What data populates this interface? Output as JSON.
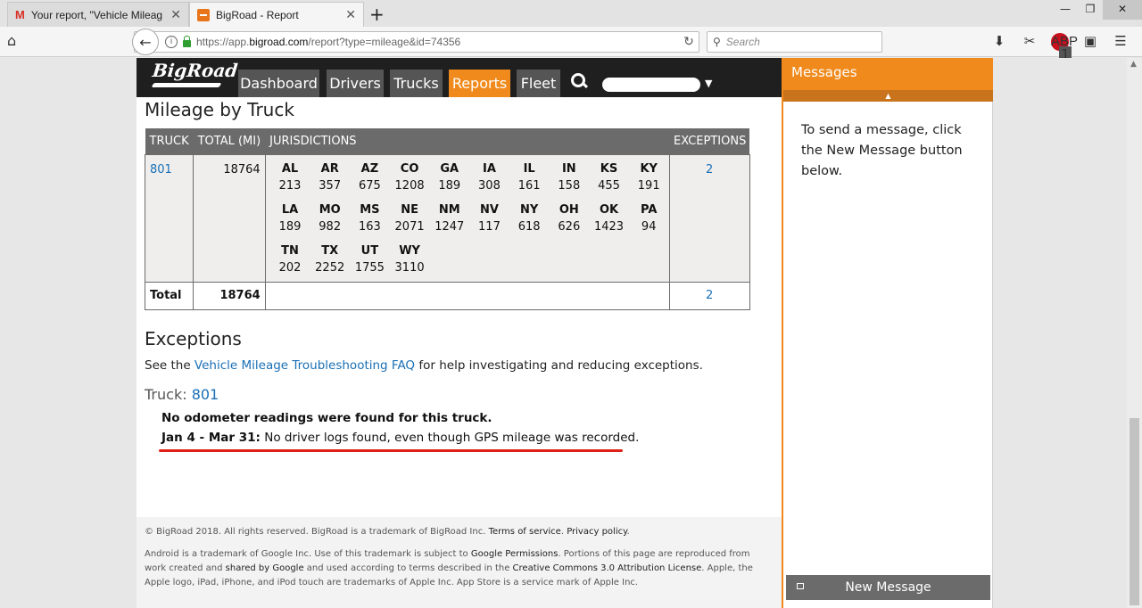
{
  "browser": {
    "tabs": [
      {
        "title": "Your report, \"Vehicle Mileag",
        "favicon": "gmail-icon",
        "active": false
      },
      {
        "title": "BigRoad - Report",
        "favicon": "bigroad-icon",
        "active": true
      }
    ],
    "url_prefix": "https://app.",
    "url_domain": "bigroad.com",
    "url_path": "/report?type=mileage&id=74356",
    "search_placeholder": "Search",
    "abp_count": "1"
  },
  "app": {
    "logo": "BigRoad",
    "nav": [
      "Dashboard",
      "Drivers",
      "Trucks",
      "Reports",
      "Fleet"
    ],
    "active_nav": "Reports"
  },
  "report": {
    "title": "Mileage by Truck",
    "headers": {
      "truck": "TRUCK",
      "total": "TOTAL (MI)",
      "jurisdictions": "JURISDICTIONS",
      "exceptions": "EXCEPTIONS"
    },
    "row": {
      "truck": "801",
      "total": "18764",
      "exceptions": "2",
      "jurisdictions": [
        {
          "code": "AL",
          "miles": "213"
        },
        {
          "code": "AR",
          "miles": "357"
        },
        {
          "code": "AZ",
          "miles": "675"
        },
        {
          "code": "CO",
          "miles": "1208"
        },
        {
          "code": "GA",
          "miles": "189"
        },
        {
          "code": "IA",
          "miles": "308"
        },
        {
          "code": "IL",
          "miles": "161"
        },
        {
          "code": "IN",
          "miles": "158"
        },
        {
          "code": "KS",
          "miles": "455"
        },
        {
          "code": "KY",
          "miles": "191"
        },
        {
          "code": "LA",
          "miles": "189"
        },
        {
          "code": "MO",
          "miles": "982"
        },
        {
          "code": "MS",
          "miles": "163"
        },
        {
          "code": "NE",
          "miles": "2071"
        },
        {
          "code": "NM",
          "miles": "1247"
        },
        {
          "code": "NV",
          "miles": "117"
        },
        {
          "code": "NY",
          "miles": "618"
        },
        {
          "code": "OH",
          "miles": "626"
        },
        {
          "code": "OK",
          "miles": "1423"
        },
        {
          "code": "PA",
          "miles": "94"
        },
        {
          "code": "TN",
          "miles": "202"
        },
        {
          "code": "TX",
          "miles": "2252"
        },
        {
          "code": "UT",
          "miles": "1755"
        },
        {
          "code": "WY",
          "miles": "3110"
        }
      ]
    },
    "total_row": {
      "label": "Total",
      "total": "18764",
      "exceptions": "2"
    },
    "exceptions_title": "Exceptions",
    "faq_prefix": "See the ",
    "faq_link": "Vehicle Mileage Troubleshooting FAQ",
    "faq_suffix": " for help investigating and reducing exceptions.",
    "truck_label": "Truck: ",
    "truck_number": "801",
    "exception_1": "No odometer readings were found for this truck.",
    "exception_2_range": "Jan 4 - Mar 31:",
    "exception_2_text": " No driver logs found, even though GPS mileage was recorded."
  },
  "footer": {
    "line1_a": "© BigRoad 2018. All rights reserved. BigRoad is a trademark of BigRoad Inc. ",
    "line1_tos": "Terms of service",
    "line1_b": ". ",
    "line1_pp": "Privacy policy",
    "line1_c": ".",
    "line2_a": "Android is a trademark of Google Inc. Use of this trademark is subject to ",
    "line2_gp": "Google Permissions",
    "line2_b": ". Portions of this page are reproduced from work created and ",
    "line2_sg": "shared by Google",
    "line2_c": " and used according to terms described in the ",
    "line2_cc": "Creative Commons 3.0 Attribution License",
    "line2_d": ". Apple, the Apple logo, iPad, iPhone, and iPod touch are trademarks of Apple Inc. App Store is a service mark of Apple Inc."
  },
  "messages": {
    "title": "Messages",
    "body": "To send a message, click the New Message button below.",
    "button": "New Message"
  }
}
